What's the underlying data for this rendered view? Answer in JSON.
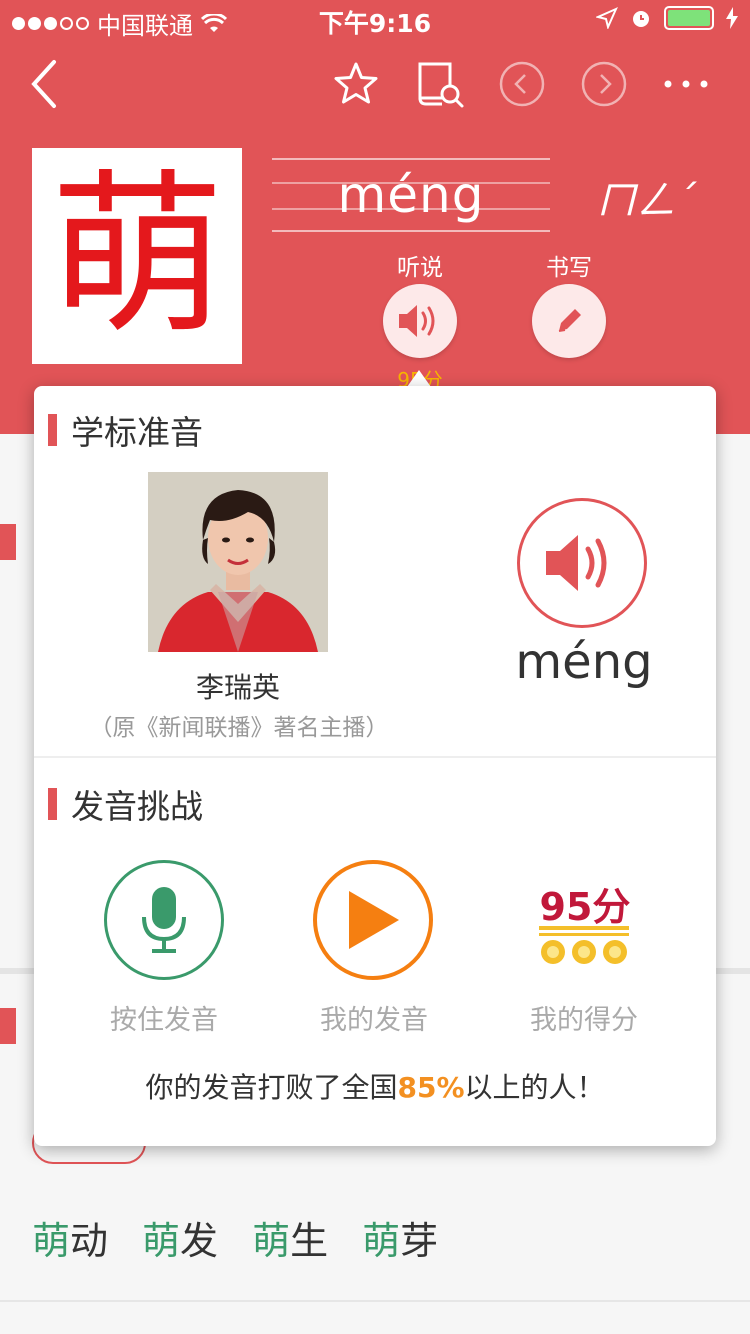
{
  "status_bar": {
    "carrier": "中国联通",
    "time": "下午9:16"
  },
  "character": {
    "hanzi": "萌",
    "pinyin": "méng",
    "zhuyin": "ㄇㄥˊ"
  },
  "tools": {
    "listen_label": "听说",
    "write_label": "书写",
    "listen_score": "95分"
  },
  "popup": {
    "section1_title": "学标准音",
    "anchor_name": "李瑞英",
    "anchor_desc": "（原《新闻联播》著名主播）",
    "pinyin": "méng",
    "section2_title": "发音挑战",
    "record_label": "按住发音",
    "playback_label": "我的发音",
    "score_label": "我的得分",
    "score_value": "95分",
    "result_prefix": "你的发音打败了全国",
    "result_pct": "85%",
    "result_suffix": "以上的人！"
  },
  "words": [
    {
      "hl": "萌",
      "rest": "动"
    },
    {
      "hl": "萌",
      "rest": "发"
    },
    {
      "hl": "萌",
      "rest": "生"
    },
    {
      "hl": "萌",
      "rest": "芽"
    }
  ],
  "colors": {
    "primary": "#e15457",
    "mic": "#3a9a6b",
    "play": "#f57f11",
    "score": "#c1183a"
  }
}
